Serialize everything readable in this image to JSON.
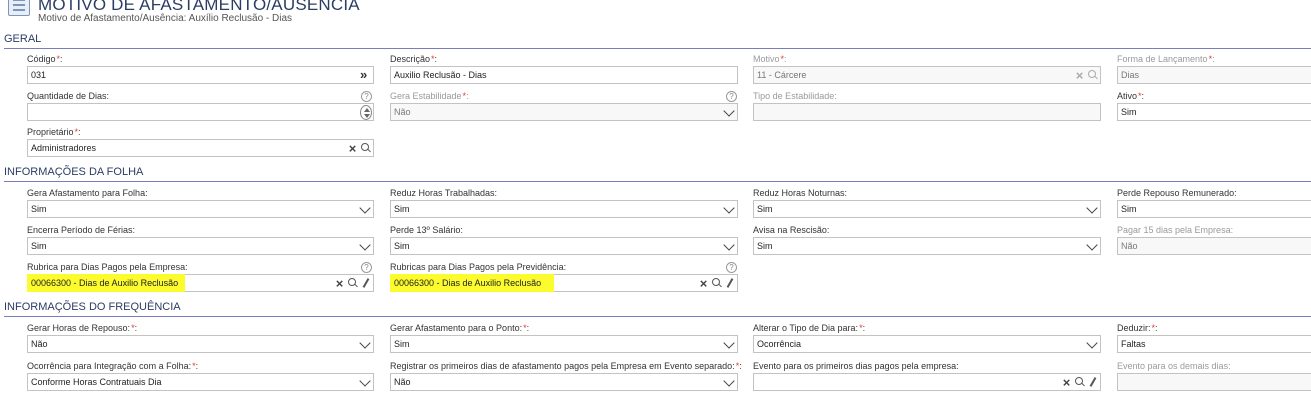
{
  "header": {
    "title": "MOTIVO DE AFASTAMENTO/AUSÊNCIA",
    "subtitle": "Motivo de Afastamento/Ausência: Auxílio Reclusão - Dias"
  },
  "sections": {
    "geral": "GERAL",
    "folha": "INFORMAÇÕES DA FOLHA",
    "frequencia": "INFORMAÇÕES DO FREQUÊNCIA"
  },
  "required_mark": "*",
  "help_glyph": "?",
  "fields": {
    "codigo": {
      "label": "Código",
      "value": "031"
    },
    "descricao": {
      "label": "Descrição",
      "value": "Auxilio Reclusão - Dias"
    },
    "motivo": {
      "label": "Motivo",
      "value": "11 - Cárcere"
    },
    "forma_lancamento": {
      "label": "Forma de Lançamento",
      "value": "Dias"
    },
    "quantidade_dias": {
      "label": "Quantidade de Dias:",
      "value": ""
    },
    "gera_estabilidade": {
      "label": "Gera Estabilidade",
      "value": "Não"
    },
    "tipo_estabilidade": {
      "label": "Tipo de Estabilidade:",
      "value": ""
    },
    "ativo": {
      "label": "Ativo",
      "value": "Sim"
    },
    "proprietario": {
      "label": "Proprietário",
      "value": "Administradores"
    },
    "gera_afastamento_folha": {
      "label": "Gera Afastamento para Folha:",
      "value": "Sim"
    },
    "reduz_horas_trabalhadas": {
      "label": "Reduz Horas Trabalhadas:",
      "value": "Sim"
    },
    "reduz_horas_noturnas": {
      "label": "Reduz Horas Noturnas:",
      "value": "Sim"
    },
    "perde_repouso": {
      "label": "Perde Repouso Remunerado:",
      "value": "Sim"
    },
    "encerra_periodo_ferias": {
      "label": "Encerra Período de Férias:",
      "value": "Sim"
    },
    "perde_13": {
      "label": "Perde 13º Salário:",
      "value": "Sim"
    },
    "avisa_rescisao": {
      "label": "Avisa na Rescisão:",
      "value": "Sim"
    },
    "pagar_15_dias": {
      "label": "Pagar 15 dias pela Empresa:",
      "value": "Não"
    },
    "rubrica_empresa": {
      "label": "Rubrica para Dias Pagos pela Empresa:",
      "value": "00066300 - Dias de Auxilio Reclusão"
    },
    "rubricas_previdencia": {
      "label": "Rubricas para Dias Pagos pela Previdência:",
      "value": "00066300 - Dias de Auxilio Reclusão"
    },
    "gerar_horas_repouso": {
      "label": "Gerar Horas de Repouso:",
      "value": "Não"
    },
    "gerar_afastamento_ponto": {
      "label": "Gerar Afastamento para o Ponto:",
      "value": "Sim"
    },
    "alterar_tipo_dia": {
      "label": "Alterar o Tipo de Dia para:",
      "value": "Ocorrência"
    },
    "deduzir": {
      "label": "Deduzir:",
      "value": "Faltas"
    },
    "ocorrencia_integracao": {
      "label": "Ocorrência para Integração com a Folha:",
      "value": "Conforme Horas Contratuais Dia"
    },
    "registrar_primeiros_dias": {
      "label": "Registrar os primeiros dias de afastamento pagos pela Empresa em Evento separado:",
      "value": "Não"
    },
    "evento_primeiros_dias": {
      "label": "Evento para os primeiros dias pagos pela empresa:",
      "value": ""
    },
    "evento_demais_dias": {
      "label": "Evento para os demais dias:",
      "value": ""
    }
  },
  "colors": {
    "section_rule": "#7b7bc0",
    "title": "#2b3d63",
    "required": "#e23a3a",
    "highlight": "#fbfb2e"
  },
  "icons": [
    "list-icon",
    "double-chevron-icon",
    "clear-x-icon",
    "search-icon",
    "edit-pencil-icon",
    "chevron-down-icon",
    "help-icon",
    "spinner-icon"
  ]
}
